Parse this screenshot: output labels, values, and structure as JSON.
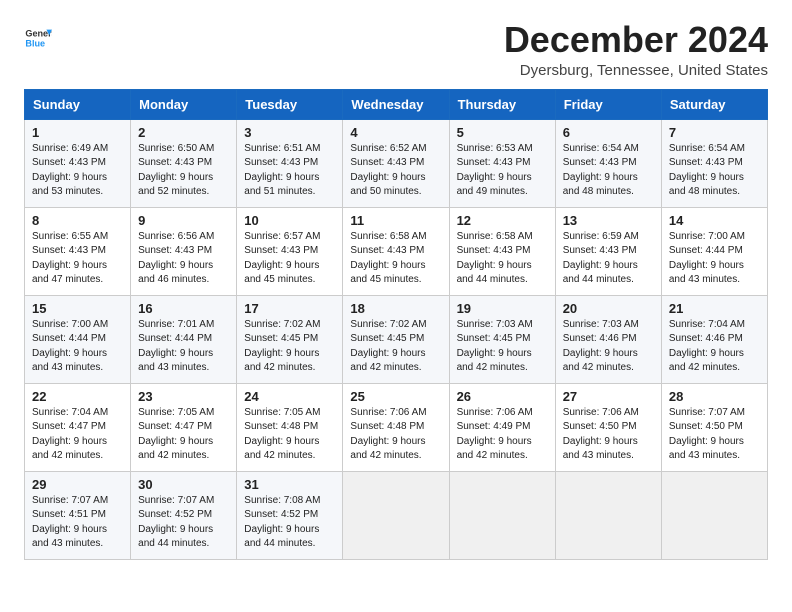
{
  "logo": {
    "text_general": "General",
    "text_blue": "Blue"
  },
  "title": "December 2024",
  "location": "Dyersburg, Tennessee, United States",
  "days_of_week": [
    "Sunday",
    "Monday",
    "Tuesday",
    "Wednesday",
    "Thursday",
    "Friday",
    "Saturday"
  ],
  "weeks": [
    [
      {
        "day": 1,
        "sunrise": "6:49 AM",
        "sunset": "4:43 PM",
        "daylight": "9 hours and 53 minutes."
      },
      {
        "day": 2,
        "sunrise": "6:50 AM",
        "sunset": "4:43 PM",
        "daylight": "9 hours and 52 minutes."
      },
      {
        "day": 3,
        "sunrise": "6:51 AM",
        "sunset": "4:43 PM",
        "daylight": "9 hours and 51 minutes."
      },
      {
        "day": 4,
        "sunrise": "6:52 AM",
        "sunset": "4:43 PM",
        "daylight": "9 hours and 50 minutes."
      },
      {
        "day": 5,
        "sunrise": "6:53 AM",
        "sunset": "4:43 PM",
        "daylight": "9 hours and 49 minutes."
      },
      {
        "day": 6,
        "sunrise": "6:54 AM",
        "sunset": "4:43 PM",
        "daylight": "9 hours and 48 minutes."
      },
      {
        "day": 7,
        "sunrise": "6:54 AM",
        "sunset": "4:43 PM",
        "daylight": "9 hours and 48 minutes."
      }
    ],
    [
      {
        "day": 8,
        "sunrise": "6:55 AM",
        "sunset": "4:43 PM",
        "daylight": "9 hours and 47 minutes."
      },
      {
        "day": 9,
        "sunrise": "6:56 AM",
        "sunset": "4:43 PM",
        "daylight": "9 hours and 46 minutes."
      },
      {
        "day": 10,
        "sunrise": "6:57 AM",
        "sunset": "4:43 PM",
        "daylight": "9 hours and 45 minutes."
      },
      {
        "day": 11,
        "sunrise": "6:58 AM",
        "sunset": "4:43 PM",
        "daylight": "9 hours and 45 minutes."
      },
      {
        "day": 12,
        "sunrise": "6:58 AM",
        "sunset": "4:43 PM",
        "daylight": "9 hours and 44 minutes."
      },
      {
        "day": 13,
        "sunrise": "6:59 AM",
        "sunset": "4:43 PM",
        "daylight": "9 hours and 44 minutes."
      },
      {
        "day": 14,
        "sunrise": "7:00 AM",
        "sunset": "4:44 PM",
        "daylight": "9 hours and 43 minutes."
      }
    ],
    [
      {
        "day": 15,
        "sunrise": "7:00 AM",
        "sunset": "4:44 PM",
        "daylight": "9 hours and 43 minutes."
      },
      {
        "day": 16,
        "sunrise": "7:01 AM",
        "sunset": "4:44 PM",
        "daylight": "9 hours and 43 minutes."
      },
      {
        "day": 17,
        "sunrise": "7:02 AM",
        "sunset": "4:45 PM",
        "daylight": "9 hours and 42 minutes."
      },
      {
        "day": 18,
        "sunrise": "7:02 AM",
        "sunset": "4:45 PM",
        "daylight": "9 hours and 42 minutes."
      },
      {
        "day": 19,
        "sunrise": "7:03 AM",
        "sunset": "4:45 PM",
        "daylight": "9 hours and 42 minutes."
      },
      {
        "day": 20,
        "sunrise": "7:03 AM",
        "sunset": "4:46 PM",
        "daylight": "9 hours and 42 minutes."
      },
      {
        "day": 21,
        "sunrise": "7:04 AM",
        "sunset": "4:46 PM",
        "daylight": "9 hours and 42 minutes."
      }
    ],
    [
      {
        "day": 22,
        "sunrise": "7:04 AM",
        "sunset": "4:47 PM",
        "daylight": "9 hours and 42 minutes."
      },
      {
        "day": 23,
        "sunrise": "7:05 AM",
        "sunset": "4:47 PM",
        "daylight": "9 hours and 42 minutes."
      },
      {
        "day": 24,
        "sunrise": "7:05 AM",
        "sunset": "4:48 PM",
        "daylight": "9 hours and 42 minutes."
      },
      {
        "day": 25,
        "sunrise": "7:06 AM",
        "sunset": "4:48 PM",
        "daylight": "9 hours and 42 minutes."
      },
      {
        "day": 26,
        "sunrise": "7:06 AM",
        "sunset": "4:49 PM",
        "daylight": "9 hours and 42 minutes."
      },
      {
        "day": 27,
        "sunrise": "7:06 AM",
        "sunset": "4:50 PM",
        "daylight": "9 hours and 43 minutes."
      },
      {
        "day": 28,
        "sunrise": "7:07 AM",
        "sunset": "4:50 PM",
        "daylight": "9 hours and 43 minutes."
      }
    ],
    [
      {
        "day": 29,
        "sunrise": "7:07 AM",
        "sunset": "4:51 PM",
        "daylight": "9 hours and 43 minutes."
      },
      {
        "day": 30,
        "sunrise": "7:07 AM",
        "sunset": "4:52 PM",
        "daylight": "9 hours and 44 minutes."
      },
      {
        "day": 31,
        "sunrise": "7:08 AM",
        "sunset": "4:52 PM",
        "daylight": "9 hours and 44 minutes."
      },
      null,
      null,
      null,
      null
    ]
  ],
  "labels": {
    "sunrise": "Sunrise:",
    "sunset": "Sunset:",
    "daylight": "Daylight:"
  }
}
